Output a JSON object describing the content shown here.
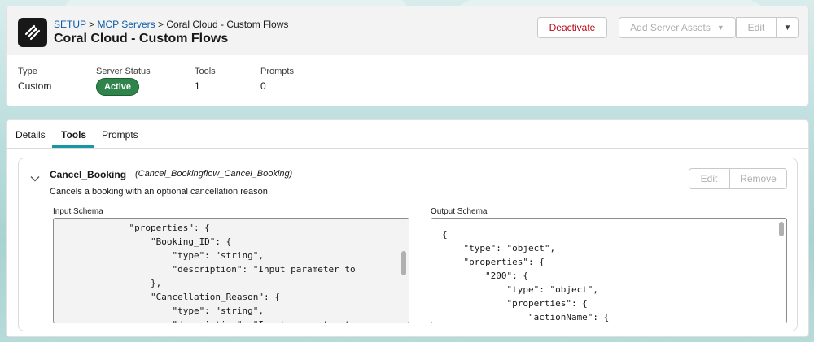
{
  "header": {
    "breadcrumb": {
      "setup": "SETUP",
      "sep1": ">",
      "mcp_servers": "MCP Servers",
      "sep2": ">",
      "current": "Coral Cloud - Custom Flows"
    },
    "title": "Coral Cloud - Custom Flows",
    "buttons": {
      "deactivate": "Deactivate",
      "add_assets": "Add Server Assets",
      "edit": "Edit"
    },
    "fields": [
      {
        "label": "Type",
        "value": "Custom"
      },
      {
        "label": "Server Status",
        "value": "Active"
      },
      {
        "label": "Tools",
        "value": "1"
      },
      {
        "label": "Prompts",
        "value": "0"
      }
    ]
  },
  "tabs": [
    "Details",
    "Tools",
    "Prompts"
  ],
  "active_tab": "Tools",
  "tool": {
    "name": "Cancel_Booking",
    "api_name": "(Cancel_Bookingflow_Cancel_Booking)",
    "description": "Cancels a booking with an optional cancellation reason",
    "edit_label": "Edit",
    "remove_label": "Remove",
    "input_schema_label": "Input Schema",
    "output_schema_label": "Output Schema",
    "input_schema_code": "            \"properties\": {\n                \"Booking_ID\": {\n                    \"type\": \"string\",\n                    \"description\": \"Input parameter to\n                },\n                \"Cancellation_Reason\": {\n                    \"type\": \"string\",\n                    \"description\": \"Input parameter to",
    "output_schema_code": "{\n    \"type\": \"object\",\n    \"properties\": {\n        \"200\": {\n            \"type\": \"object\",\n            \"properties\": {\n                \"actionName\": {"
  },
  "colors": {
    "status_active": "#2e844a",
    "link": "#0b5cab",
    "danger": "#ba0517",
    "tab_accent": "#1b96a5"
  }
}
